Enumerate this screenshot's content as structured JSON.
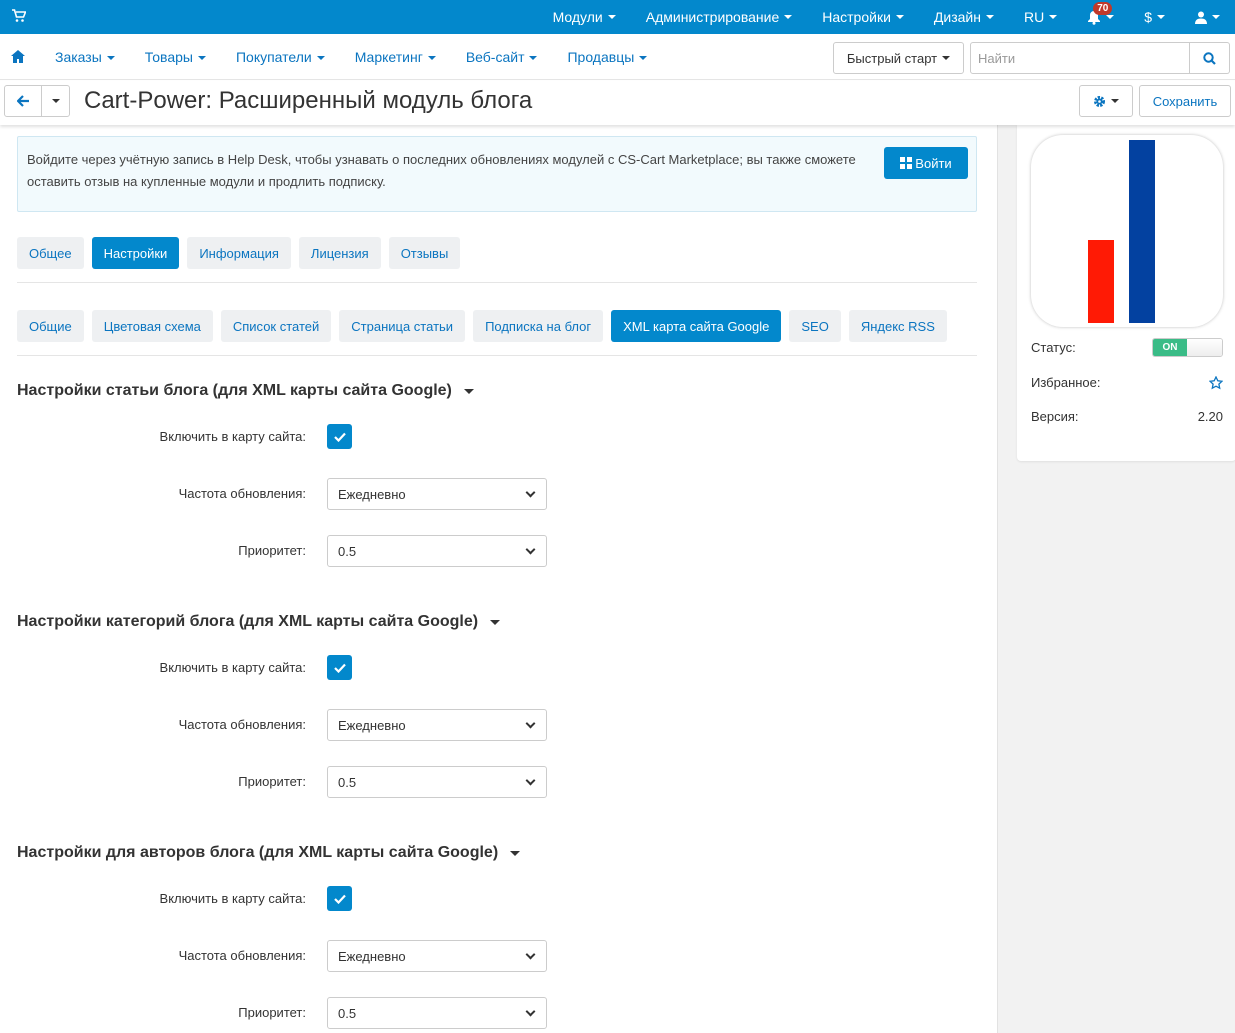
{
  "topbar": {
    "menu": [
      "Модули",
      "Администрирование",
      "Настройки",
      "Дизайн",
      "RU"
    ],
    "notifications_count": "70",
    "currency": "$"
  },
  "nav": {
    "items": [
      "Заказы",
      "Товары",
      "Покупатели",
      "Маркетинг",
      "Веб-сайт",
      "Продавцы"
    ],
    "quick_start": "Быстрый старт",
    "search_placeholder": "Найти"
  },
  "page": {
    "title": "Cart-Power: Расширенный модуль блога",
    "save_label": "Сохранить"
  },
  "notice": {
    "text": "Войдите через учётную запись в Help Desk, чтобы узнавать о последних обновлениях модулей с CS-Cart Marketplace; вы также сможете оставить отзыв на купленные модули и продлить подписку.",
    "login_label": "Войти"
  },
  "tabs": [
    "Общее",
    "Настройки",
    "Информация",
    "Лицензия",
    "Отзывы"
  ],
  "subtabs": [
    "Общие",
    "Цветовая схема",
    "Список статей",
    "Страница статьи",
    "Подписка на блог",
    "XML карта сайта Google",
    "SEO",
    "Яндекс RSS"
  ],
  "labels": {
    "include": "Включить в карту сайта:",
    "frequency": "Частота обновления:",
    "priority": "Приоритет:"
  },
  "sections": [
    {
      "title": "Настройки статьи блога (для XML карты сайта Google)",
      "include": true,
      "frequency": "Ежедневно",
      "priority": "0.5"
    },
    {
      "title": "Настройки категорий блога (для XML карты сайта Google)",
      "include": true,
      "frequency": "Ежедневно",
      "priority": "0.5"
    },
    {
      "title": "Настройки для авторов блога (для XML карты сайта Google)",
      "include": true,
      "frequency": "Ежедневно",
      "priority": "0.5"
    }
  ],
  "sidebar": {
    "status_label": "Статус:",
    "status_value": "ON",
    "favorite_label": "Избранное:",
    "version_label": "Версия:",
    "version_value": "2.20"
  },
  "colors": {
    "primary": "#0388cc",
    "link": "#0b75c0",
    "on": "#3abc87",
    "logo_red": "#ff1a05",
    "logo_blue": "#0341a0"
  }
}
